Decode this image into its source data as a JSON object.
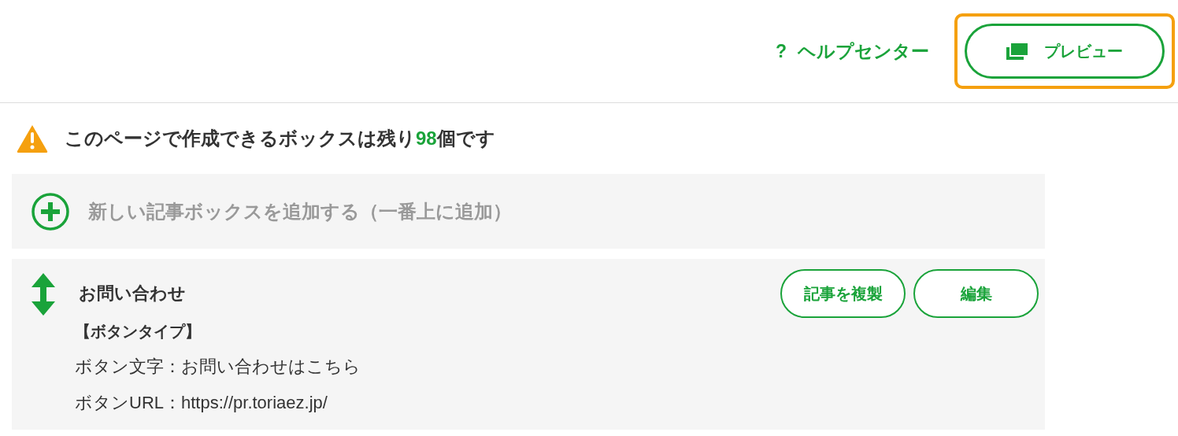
{
  "header": {
    "help_link": {
      "icon": "?",
      "label": "ヘルプセンター"
    },
    "preview_button": {
      "label": "プレビュー",
      "highlighted": true
    }
  },
  "notice": {
    "before": "このページで作成できるボックスは残り",
    "count": "98",
    "after": "個です"
  },
  "add_box": {
    "label": "新しい記事ボックスを追加する（一番上に追加）"
  },
  "articles": [
    {
      "title": "お問い合わせ",
      "type_label": "【ボタンタイプ】",
      "lines": [
        "ボタン文字：お問い合わせはこちら",
        "ボタンURL：https://pr.toriaez.jp/"
      ],
      "buttons": [
        "記事を複製",
        "編集"
      ]
    }
  ]
}
